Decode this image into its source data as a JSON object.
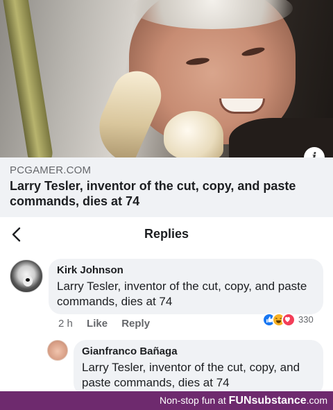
{
  "link_card": {
    "domain": "PCGAMER.COM",
    "headline": "Larry Tesler, inventor of the cut, copy, and paste commands, dies at 74",
    "info_icon": "info-icon"
  },
  "replies_header": {
    "back_icon": "chevron-left-icon",
    "title": "Replies"
  },
  "comments": [
    {
      "author": "Kirk Johnson",
      "text": "Larry Tesler, inventor of the cut, copy, and paste commands, dies at 74",
      "time": "2 h",
      "like_label": "Like",
      "reply_label": "Reply",
      "reactions": [
        "like",
        "haha",
        "love"
      ],
      "reaction_count": "330"
    },
    {
      "author": "Gianfranco Bañaga",
      "text": "Larry Tesler, inventor of the cut, copy, and paste commands, dies at 74"
    }
  ],
  "footer": {
    "lead": "Non-stop fun at ",
    "brand": "FUNsubstance",
    "suffix": ".com"
  },
  "colors": {
    "footer_bg": "#6e2a6e",
    "like": "#1877f2",
    "haha": "#f7b125",
    "love": "#f33e58"
  }
}
